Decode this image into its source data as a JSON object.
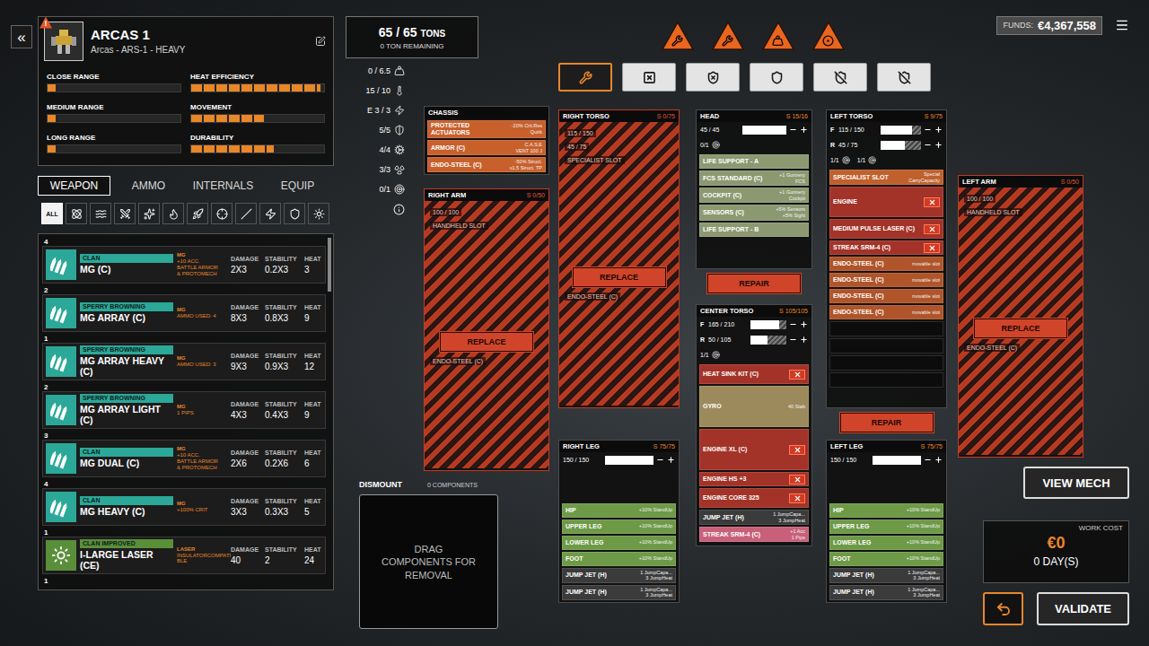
{
  "header": {
    "back": "«",
    "alert": "!",
    "title": "ARCAS 1",
    "subtitle": "Arcas - ARS-1 - HEAVY"
  },
  "stats": [
    {
      "label": "CLOSE RANGE",
      "level": 0.06
    },
    {
      "label": "HEAT EFFICIENCY",
      "level": 0.97
    },
    {
      "label": "MEDIUM RANGE",
      "level": 0.06
    },
    {
      "label": "MOVEMENT",
      "level": 0.55
    },
    {
      "label": "LONG RANGE",
      "level": 0.06
    },
    {
      "label": "DURABILITY",
      "level": 0.62
    }
  ],
  "tabs": [
    {
      "label": "WEAPON",
      "selected": true
    },
    {
      "label": "AMMO",
      "selected": false
    },
    {
      "label": "INTERNALS",
      "selected": false
    },
    {
      "label": "EQUIP",
      "selected": false
    }
  ],
  "filters": [
    {
      "label": "ALL",
      "selected": true
    },
    {
      "selected": false
    },
    {
      "selected": false
    },
    {
      "selected": false
    },
    {
      "selected": false
    },
    {
      "selected": false
    },
    {
      "selected": false
    },
    {
      "selected": false
    },
    {
      "selected": false
    },
    {
      "selected": false
    },
    {
      "selected": false
    },
    {
      "selected": false
    }
  ],
  "weapon_columns": [
    "DAMAGE",
    "STABILITY",
    "HEAT"
  ],
  "weapons": [
    {
      "qty": "4",
      "kind": "mg",
      "brand": "CLAN",
      "color": "#2ba898",
      "name": "MG (C)",
      "tags": [
        "MG",
        "+10 ACC.",
        "BATTLE ARMOR",
        "& PROTOMECH"
      ],
      "damage": "2X3",
      "stability": "0.2X3",
      "heat": "3"
    },
    {
      "qty": "2",
      "kind": "mg",
      "brand": "SPERRY BROWNING",
      "color": "#2ba898",
      "name": "MG ARRAY (C)",
      "tags": [
        "MG",
        "AMMO USED: 4"
      ],
      "damage": "8X3",
      "stability": "0.8X3",
      "heat": "9"
    },
    {
      "qty": "1",
      "kind": "mg",
      "brand": "SPERRY BROWNING",
      "color": "#2ba898",
      "name": "MG ARRAY HEAVY (C)",
      "tags": [
        "MG",
        "AMMO USED: 3"
      ],
      "damage": "9X3",
      "stability": "0.9X3",
      "heat": "12"
    },
    {
      "qty": "2",
      "kind": "mg",
      "brand": "SPERRY BROWNING",
      "color": "#2ba898",
      "name": "MG ARRAY LIGHT (C)",
      "tags": [
        "MG",
        "1 PIPS"
      ],
      "damage": "4X3",
      "stability": "0.4X3",
      "heat": "9"
    },
    {
      "qty": "3",
      "kind": "mg",
      "brand": "CLAN",
      "color": "#2ba898",
      "name": "MG DUAL (C)",
      "tags": [
        "MG",
        "+10 ACC.",
        "BATTLE ARMOR",
        "& PROTOMECH"
      ],
      "damage": "2X6",
      "stability": "0.2X6",
      "heat": "6"
    },
    {
      "qty": "4",
      "kind": "mg",
      "brand": "CLAN",
      "color": "#2ba898",
      "name": "MG HEAVY (C)",
      "tags": [
        "MG",
        "+100% CRIT"
      ],
      "damage": "3X3",
      "stability": "0.3X3",
      "heat": "5"
    },
    {
      "qty": "1",
      "kind": "laser",
      "brand": "CLAN IMPROVED",
      "color": "#5a8f3a",
      "name": "I-LARGE LASER (CE)",
      "tags": [
        "LASER",
        "INSULATORCOMPATI",
        "BLE"
      ],
      "damage": "40",
      "stability": "2",
      "heat": "24"
    }
  ],
  "more_count": "1",
  "tonnage": {
    "value": "65 / 65",
    "unit": "TONS",
    "remaining": "0 TON REMAINING"
  },
  "side_stats": [
    {
      "value": "0 / 6.5"
    },
    {
      "value": "15 / 10"
    },
    {
      "value": "E 3 / 3"
    },
    {
      "value": "5/5"
    },
    {
      "value": "4/4"
    },
    {
      "value": "3/3"
    },
    {
      "value": "0/1"
    }
  ],
  "warnings": [
    {
      "active": true
    },
    {
      "active": true
    },
    {
      "active": true
    },
    {
      "active": true
    }
  ],
  "slot_filters": [
    {
      "selected": true
    },
    {
      "selected": false
    },
    {
      "selected": false
    },
    {
      "selected": false
    },
    {
      "selected": false
    },
    {
      "selected": false
    }
  ],
  "funds": {
    "label": "FUNDS:",
    "value": "€4,367,558"
  },
  "chassis": {
    "title": "CHASSIS",
    "items": [
      {
        "label": "PROTECTED ACTUATORS",
        "detail": [
          "-20% Crit.Res",
          "Quirk"
        ],
        "color": "#c8602c",
        "kind": "single",
        "removable": false
      },
      {
        "label": "ARMOR (C)",
        "detail": [
          "C.A.S.E",
          "VENT 100 J"
        ],
        "color": "#c8602c",
        "kind": "single",
        "removable": false
      },
      {
        "label": "ENDO-STEEL (C)",
        "detail": [
          "-50% Struct.",
          "x1.5 Struct. TP"
        ],
        "color": "#c8602c",
        "kind": "single",
        "removable": false
      }
    ]
  },
  "locations": {
    "right_arm": {
      "title": "RIGHT ARM",
      "cap": "S 0/50",
      "destroyed": true,
      "ghost_above": [
        "100 / 100",
        "HANDHELD SLOT"
      ],
      "ghost_below": [
        "ENDO-STEEL (C)"
      ],
      "action": "REPLACE"
    },
    "right_torso": {
      "title": "RIGHT TORSO",
      "cap": "S 0/75",
      "destroyed": true,
      "ghost_above": [
        "115 / 150",
        "45 / 75",
        "SPECIALIST SLOT"
      ],
      "ghost_below": [
        "ENDO-STEEL (C)"
      ],
      "action": "REPLACE"
    },
    "left_arm": {
      "title": "LEFT ARM",
      "cap": "S 0/50",
      "destroyed": true,
      "ghost_above": [
        "100 / 100",
        "HANDHELD SLOT"
      ],
      "ghost_below": [
        "ENDO-STEEL (C)"
      ],
      "action": "REPLACE"
    },
    "head": {
      "title": "HEAD",
      "cap": "S 15/16",
      "destroyed": false,
      "armor": [
        {
          "label": "",
          "value": "45 / 45",
          "level": 1
        }
      ],
      "counters": [
        "0/1"
      ],
      "action": "REPAIR",
      "items": [
        {
          "label": "LIFE SUPPORT - A",
          "detail": [],
          "color": "#8c9970",
          "kind": "single",
          "removable": false
        },
        {
          "label": "FCS STANDARD (C)",
          "detail": [
            "+1 Gunnery",
            "FCS"
          ],
          "color": "#8c9970",
          "kind": "single",
          "removable": false
        },
        {
          "label": "COCKPIT (C)",
          "detail": [
            "+1 Gunnery",
            "Cockpit"
          ],
          "color": "#8c9970",
          "kind": "single",
          "removable": false
        },
        {
          "label": "SENSORS (C)",
          "detail": [
            "+5% Sensors",
            "+5% Sight"
          ],
          "color": "#8c9970",
          "kind": "single",
          "removable": false
        },
        {
          "label": "LIFE SUPPORT - B",
          "detail": [],
          "color": "#8c9970",
          "kind": "single",
          "removable": false
        }
      ]
    },
    "left_torso": {
      "title": "LEFT TORSO",
      "cap": "S 9/75",
      "destroyed": false,
      "armor": [
        {
          "label": "F",
          "value": "115 / 150",
          "level": 0.77
        },
        {
          "label": "R",
          "value": "45 / 75",
          "level": 0.6
        }
      ],
      "counters": [
        "1/1",
        "1/1"
      ],
      "action": "REPAIR",
      "items": [
        {
          "label": "SPECIALIST SLOT",
          "detail": [
            "Special",
            "CarryCapacity"
          ],
          "color": "#c0602c",
          "kind": "single",
          "removable": false
        },
        {
          "label": "ENGINE",
          "detail": [],
          "color": "#a33328",
          "kind": "triple",
          "removable": true
        },
        {
          "label": "MEDIUM PULSE LASER (C)",
          "detail": [],
          "color": "#a33328",
          "kind": "double",
          "removable": true
        },
        {
          "label": "STREAK SRM-4 (C)",
          "detail": [],
          "color": "#a33328",
          "kind": "single",
          "removable": true
        },
        {
          "label": "ENDO-STEEL (C)",
          "detail": [
            "movable slot"
          ],
          "color": "#b0542a",
          "kind": "single",
          "removable": false
        },
        {
          "label": "ENDO-STEEL (C)",
          "detail": [
            "movable slot"
          ],
          "color": "#b0542a",
          "kind": "single",
          "removable": false
        },
        {
          "label": "ENDO-STEEL (C)",
          "detail": [
            "movable slot"
          ],
          "color": "#b0542a",
          "kind": "single",
          "removable": false
        },
        {
          "label": "ENDO-STEEL (C)",
          "detail": [
            "movable slot"
          ],
          "color": "#b0542a",
          "kind": "single",
          "removable": false
        },
        {
          "kind": "empty"
        },
        {
          "kind": "empty"
        },
        {
          "kind": "empty"
        },
        {
          "kind": "empty"
        }
      ]
    },
    "center_torso": {
      "title": "CENTER TORSO",
      "cap": "S 105/105",
      "destroyed": false,
      "armor": [
        {
          "label": "F",
          "value": "165 / 210",
          "level": 0.79
        },
        {
          "label": "R",
          "value": "50 / 105",
          "level": 0.48
        }
      ],
      "counters": [
        "1/1"
      ],
      "items": [
        {
          "label": "HEAT SINK KIT (C)",
          "detail": [],
          "color": "#a33328",
          "kind": "double",
          "removable": true
        },
        {
          "label": "GYRO",
          "detail": [
            "40 Stab"
          ],
          "color": "#9c8a5c",
          "kind": "tall",
          "removable": false
        },
        {
          "label": "ENGINE XL (C)",
          "detail": [],
          "color": "#a33328",
          "kind": "tall",
          "removable": true
        },
        {
          "label": "ENGINE HS +3",
          "detail": [],
          "color": "#a33328",
          "kind": "single",
          "removable": true
        },
        {
          "label": "ENGINE CORE 325",
          "detail": [],
          "color": "#a33328",
          "kind": "double",
          "removable": true
        },
        {
          "label": "JUMP JET (H)",
          "detail": [
            "1 JumpCapa...",
            "3 JumpHeat"
          ],
          "color": "#3b3b3b",
          "kind": "single",
          "removable": false
        },
        {
          "label": "STREAK SRM-4 (C)",
          "detail": [
            "+1 Acc",
            "1 Pips"
          ],
          "color": "#c8607a",
          "kind": "single",
          "removable": false
        }
      ]
    },
    "right_leg": {
      "title": "RIGHT LEG",
      "cap": "S 75/75",
      "destroyed": false,
      "armor": [
        {
          "label": "",
          "value": "150 / 150",
          "level": 1
        }
      ],
      "counters": [],
      "items": [
        {
          "label": "HIP",
          "detail": [
            "+10% StandUp"
          ],
          "color": "#6e9a48",
          "kind": "single",
          "removable": false
        },
        {
          "label": "UPPER LEG",
          "detail": [
            "+10% StandUp"
          ],
          "color": "#6e9a48",
          "kind": "single",
          "removable": false
        },
        {
          "label": "LOWER LEG",
          "detail": [
            "+10% StandUp"
          ],
          "color": "#6e9a48",
          "kind": "single",
          "removable": false
        },
        {
          "label": "FOOT",
          "detail": [
            "+10% StandUp"
          ],
          "color": "#6e9a48",
          "kind": "single",
          "removable": false
        },
        {
          "label": "JUMP JET (H)",
          "detail": [
            "1 JumpCapa...",
            "3 JumpHeat"
          ],
          "color": "#3b3b3b",
          "kind": "single",
          "removable": false
        },
        {
          "label": "JUMP JET (H)",
          "detail": [
            "1 JumpCapa...",
            "3 JumpHeat"
          ],
          "color": "#3b3b3b",
          "kind": "single",
          "removable": false
        }
      ]
    },
    "left_leg": {
      "title": "LEFT LEG",
      "cap": "S 75/75",
      "destroyed": false,
      "armor": [
        {
          "label": "",
          "value": "150 / 150",
          "level": 1
        }
      ],
      "counters": [],
      "items": [
        {
          "label": "HIP",
          "detail": [
            "+10% StandUp"
          ],
          "color": "#6e9a48",
          "kind": "single",
          "removable": false
        },
        {
          "label": "UPPER LEG",
          "detail": [
            "+10% StandUp"
          ],
          "color": "#6e9a48",
          "kind": "single",
          "removable": false
        },
        {
          "label": "LOWER LEG",
          "detail": [
            "+10% StandUp"
          ],
          "color": "#6e9a48",
          "kind": "single",
          "removable": false
        },
        {
          "label": "FOOT",
          "detail": [
            "+10% StandUp"
          ],
          "color": "#6e9a48",
          "kind": "single",
          "removable": false
        },
        {
          "label": "JUMP JET (H)",
          "detail": [
            "1 JumpCapa...",
            "3 JumpHeat"
          ],
          "color": "#3b3b3b",
          "kind": "single",
          "removable": false
        },
        {
          "label": "JUMP JET (H)",
          "detail": [
            "1 JumpCapa...",
            "3 JumpHeat"
          ],
          "color": "#3b3b3b",
          "kind": "single",
          "removable": false
        }
      ]
    }
  },
  "dismount": {
    "title": "DISMOUNT",
    "count": "0 COMPONENTS",
    "hint": "DRAG COMPONENTS FOR REMOVAL"
  },
  "actions": {
    "view": "VIEW MECH",
    "work_label": "WORK COST",
    "work_cost": "€0",
    "work_days": "0 DAY(S)",
    "validate": "VALIDATE"
  }
}
